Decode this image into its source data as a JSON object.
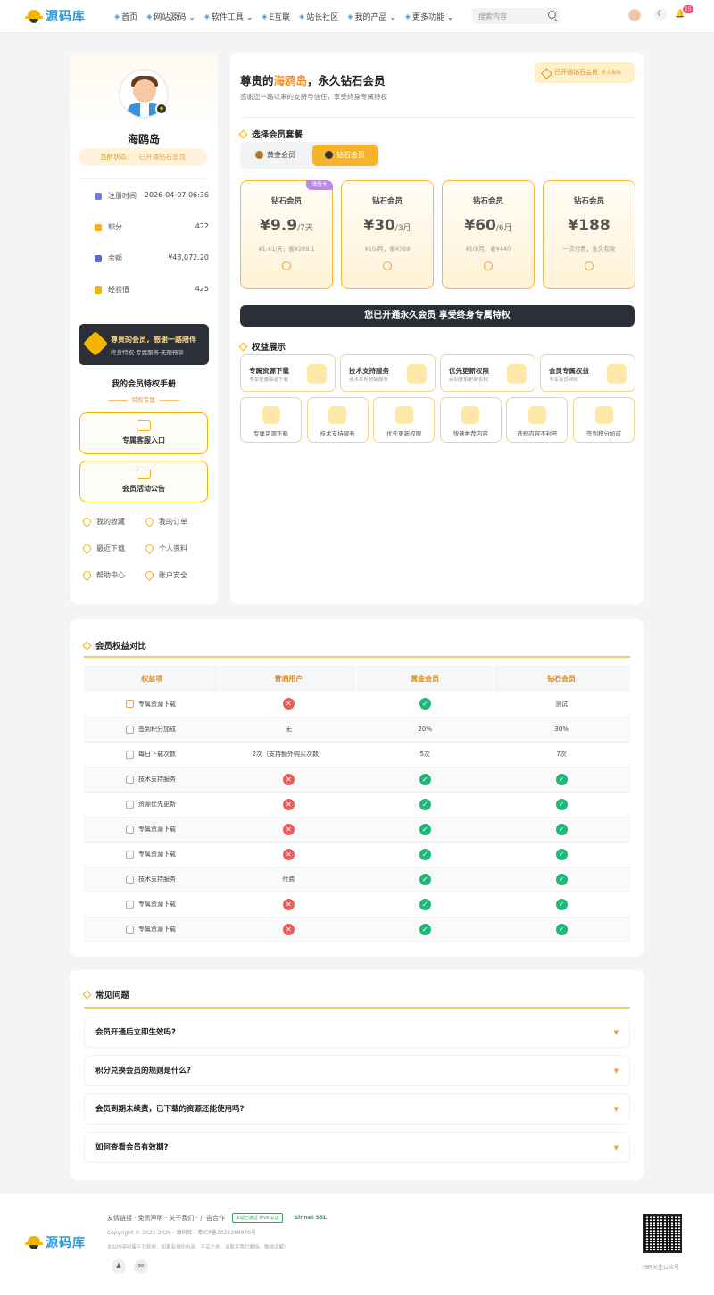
{
  "header": {
    "logo_text": "源码库",
    "nav": [
      {
        "label": "首页",
        "icon": "home-icon"
      },
      {
        "label": "网站源码 ⌄",
        "icon": "globe-icon"
      },
      {
        "label": "软件工具 ⌄",
        "icon": "tool-icon"
      },
      {
        "label": "E互联",
        "icon": "link-icon"
      },
      {
        "label": "站长社区",
        "icon": "chat-icon"
      },
      {
        "label": "我的产品 ⌄",
        "icon": "product-icon"
      },
      {
        "label": "更多功能 ⌄",
        "icon": "grid-icon"
      }
    ],
    "search_placeholder": "搜索内容",
    "notif_count": "15"
  },
  "profile": {
    "name": "海鸥岛",
    "status_label": "当前状态：",
    "status_value": "已开通钻石会员",
    "stats": [
      {
        "label": "注册时间",
        "value": "2026-04-07 06:36",
        "color": "#6b7fe0"
      },
      {
        "label": "积分",
        "value": "422",
        "color": "#f4b400"
      },
      {
        "label": "余额",
        "value": "¥43,072.20",
        "color": "#4a70d8"
      },
      {
        "label": "经验值",
        "value": "425",
        "color": "#f4b400"
      }
    ],
    "promo_title": "尊贵的会员，感谢一路陪伴",
    "promo_sub": "终身特权·专属服务·无限畅享",
    "handbook_title": "我的会员特权手册",
    "handbook_sub": "特权专属",
    "entries": [
      "专属客服入口",
      "会员活动公告"
    ],
    "links": [
      "我的收藏",
      "我的订单",
      "最近下载",
      "个人资料",
      "帮助中心",
      "账户安全"
    ]
  },
  "main": {
    "welcome_pre": "尊贵的",
    "welcome_name": "海鸥岛",
    "welcome_post": "，永久钻石会员",
    "welcome_sub": "感谢您一路以来的支持与信任，享受终身专属特权",
    "vip_badge": "已开通钻石会员",
    "vip_badge_small": "永久有效",
    "choose_title": "选择会员套餐",
    "tabs": [
      "黄金会员",
      "钻石会员"
    ],
    "plans": [
      {
        "name": "钻石会员",
        "price": "¥9.9",
        "unit": "/7天",
        "desc": "¥1.41/天，省¥289.1",
        "tag": "体验卡"
      },
      {
        "name": "钻石会员",
        "price": "¥30",
        "unit": "/3月",
        "desc": "¥10/月，省¥369",
        "tag": ""
      },
      {
        "name": "钻石会员",
        "price": "¥60",
        "unit": "/6月",
        "desc": "¥10/月，省¥440",
        "tag": ""
      },
      {
        "name": "钻石会员",
        "price": "¥188",
        "unit": "",
        "desc": "一次付费，永久有效",
        "tag": ""
      }
    ],
    "opened_banner": "您已开通永久会员  享受终身专属特权",
    "benefit_title": "权益展示",
    "benefits": [
      {
        "title": "专属资源下载",
        "sub": "专享便捷高速下载"
      },
      {
        "title": "技术支持服务",
        "sub": "技术实时答疑服务"
      },
      {
        "title": "优先更新权限",
        "sub": "启动获取更新资格"
      },
      {
        "title": "会员专属权益",
        "sub": "专享会员特权"
      }
    ],
    "tiles": [
      "专属资源下载",
      "技术支持服务",
      "优先更新权限",
      "快速推荐内容",
      "违规内容不封号",
      "签到积分加成"
    ]
  },
  "compare": {
    "title": "会员权益对比",
    "headers": [
      "权益项",
      "普通用户",
      "黄金会员",
      "钻石会员"
    ],
    "rows": [
      {
        "name": "专属资源下载",
        "c": [
          "x",
          "y",
          "测试"
        ]
      },
      {
        "name": "签到积分加成",
        "c": [
          "无",
          "20%",
          "30%"
        ]
      },
      {
        "name": "每日下载次数",
        "c": [
          "2次（支持额外购买次数）",
          "5次",
          "7次"
        ]
      },
      {
        "name": "技术支持服务",
        "c": [
          "x",
          "y",
          "y"
        ]
      },
      {
        "name": "资源优先更新",
        "c": [
          "x",
          "y",
          "y"
        ]
      },
      {
        "name": "专属资源下载",
        "c": [
          "x",
          "y",
          "y"
        ]
      },
      {
        "name": "专属资源下载",
        "c": [
          "x",
          "y",
          "y"
        ]
      },
      {
        "name": "技术支持服务",
        "c": [
          "付费",
          "y",
          "y"
        ]
      },
      {
        "name": "专属资源下载",
        "c": [
          "x",
          "y",
          "y"
        ]
      },
      {
        "name": "专属资源下载",
        "c": [
          "x",
          "y",
          "y"
        ]
      }
    ]
  },
  "faq": {
    "title": "常见问题",
    "items": [
      "会员开通后立即生效吗?",
      "积分兑换会员的规则是什么?",
      "会员到期未续费，已下载的资源还能使用吗?",
      "如何查看会员有效期?"
    ]
  },
  "footer": {
    "links": "友情链接 · 免责声明 · 关于我们 · 广告合作",
    "badge": "本站已通过 IPv6 认证",
    "ssl": "Sinnet SSL",
    "copyright": "Copyright © 2022-2026 · 源码库 · 粤ICP备2024268970号",
    "note": "本站内容收集于互联网，如果有侵权内容、不妥之处，请联系我们删除。敬请谅解!",
    "qr_text": "扫码关注公众号"
  }
}
